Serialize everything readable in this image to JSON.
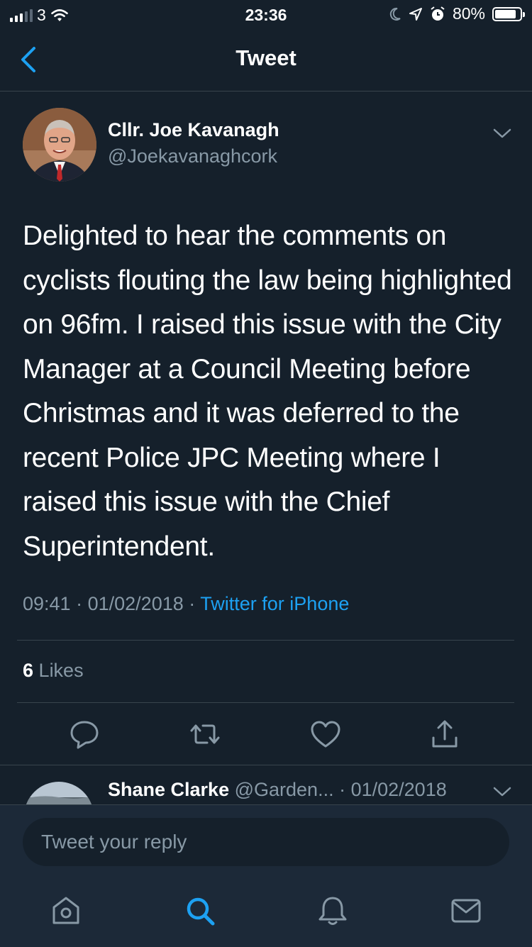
{
  "status_bar": {
    "carrier": "3",
    "time": "23:36",
    "battery": "80%"
  },
  "nav": {
    "title": "Tweet"
  },
  "tweet": {
    "display_name": "Cllr. Joe Kavanagh",
    "handle": "@Joekavanaghcork",
    "text": "Delighted to hear the comments on cyclists flouting the law being highlighted on 96fm. I raised this issue with the City Manager at a Council Meeting before Christmas and it was deferred to the recent Police JPC Meeting where I raised this issue with the Chief Superintendent.",
    "time": "09:41",
    "date": "01/02/2018",
    "separator": "·",
    "source": "Twitter for iPhone",
    "likes_count": "6",
    "likes_label": "Likes"
  },
  "reply_preview": {
    "display_name": "Shane Clarke",
    "handle": "@Garden...",
    "date": "· 01/02/2018"
  },
  "composer": {
    "placeholder": "Tweet your reply"
  },
  "icons": {
    "accent": "#1da1f2",
    "secondary": "#8899a6",
    "background": "#15202b"
  }
}
